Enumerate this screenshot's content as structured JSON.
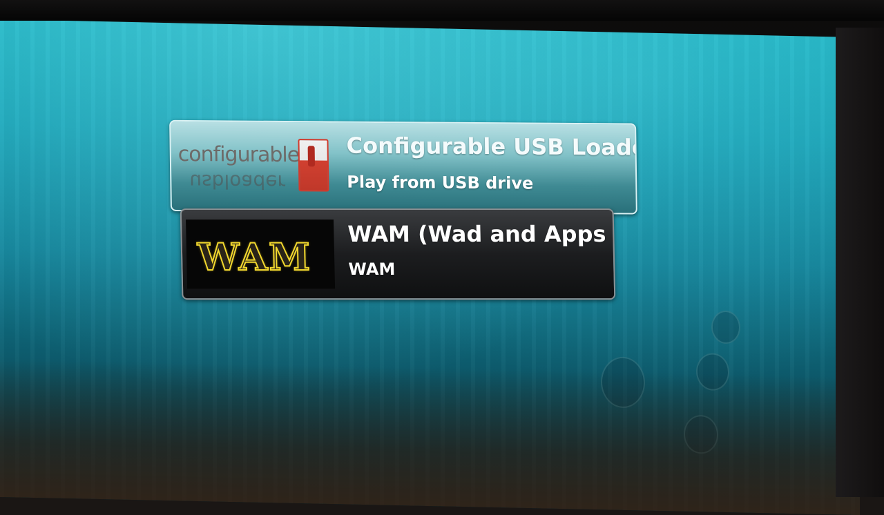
{
  "menu": {
    "items": [
      {
        "title": "Configurable USB Loader",
        "subtitle": "Play from USB drive",
        "thumb_text": "configurable",
        "thumb_reflection": "usbloader"
      },
      {
        "title": "WAM (Wad and Apps Manag",
        "subtitle": "WAM",
        "thumb_text": "WAM"
      }
    ]
  },
  "colors": {
    "screen_background": "#17a2b6",
    "selected_item": "#82c2c8",
    "unselected_item": "#1c1d1f",
    "wam_logo": "#f2d82e",
    "switch_red": "#d04030"
  },
  "icons": {
    "cfg_thumb": "power-switch-icon",
    "wam_thumb": "wam-logo-icon"
  }
}
